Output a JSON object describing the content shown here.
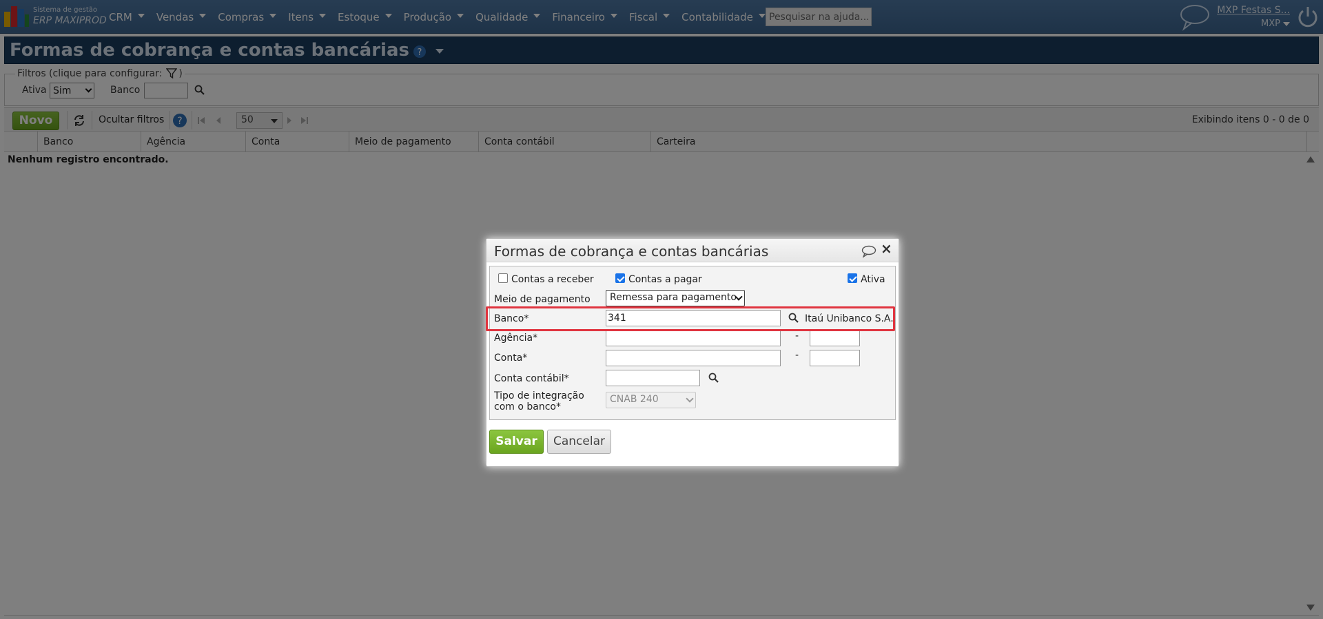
{
  "app": {
    "logo_line1": "Sistema de gestão",
    "logo_line2": "ERP MAXIPROD"
  },
  "nav": {
    "items": [
      "CRM",
      "Vendas",
      "Compras",
      "Itens",
      "Estoque",
      "Produção",
      "Qualidade",
      "Financeiro",
      "Fiscal",
      "Contabilidade"
    ],
    "search_placeholder": "Pesquisar na ajuda...",
    "user_name": "MXP Festas S...",
    "company": "MXP"
  },
  "page": {
    "title": "Formas de cobrança e contas bancárias"
  },
  "filters": {
    "legend": "Filtros (clique para configurar:",
    "legend_close": ")",
    "ativa_label": "Ativa",
    "ativa_value": "Sim",
    "banco_label": "Banco"
  },
  "toolbar": {
    "novo": "Novo",
    "hide_filters": "Ocultar filtros",
    "page_size": "50",
    "status": "Exibindo itens 0 - 0 de 0"
  },
  "grid": {
    "columns": [
      "Banco",
      "Agência",
      "Conta",
      "Meio de pagamento",
      "Conta contábil",
      "Carteira"
    ],
    "empty": "Nenhum registro encontrado."
  },
  "modal": {
    "title": "Formas de cobrança e contas bancárias",
    "contas_receber": "Contas a receber",
    "contas_receber_checked": false,
    "contas_pagar": "Contas a pagar",
    "contas_pagar_checked": true,
    "ativa": "Ativa",
    "ativa_checked": true,
    "meio_label": "Meio de pagamento",
    "meio_value": "Remessa para pagamento",
    "banco_label": "Banco*",
    "banco_value": "341",
    "banco_name": "Itaú Unibanco S.A.",
    "agencia_label": "Agência*",
    "conta_label": "Conta*",
    "dash": "-",
    "conta_contabil_label": "Conta contábil*",
    "tipo_label_1": "Tipo de integração",
    "tipo_label_2": "com o banco*",
    "tipo_value": "CNAB 240",
    "save": "Salvar",
    "cancel": "Cancelar"
  },
  "colors": {
    "topbar": "#4a74a0",
    "page_header": "#1b3c5f",
    "accent_green": "#7ab82e",
    "highlight": "#e0343f"
  }
}
